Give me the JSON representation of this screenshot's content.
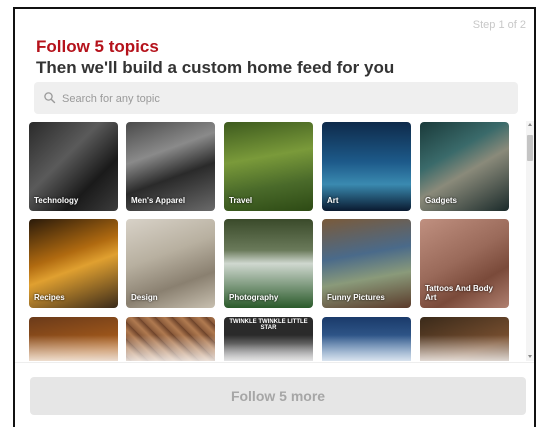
{
  "modal": {
    "step": "Step 1 of 2",
    "title": "Follow 5 topics",
    "subtitle": "Then we'll build a custom home feed for you"
  },
  "search": {
    "placeholder": "Search for any topic",
    "icon": "search-icon"
  },
  "topics": [
    {
      "label": "Technology",
      "background": "linear-gradient(135deg,#2a2a2a 0%,#5a5a5a 40%,#1a1a1a 70%,#3c3c3c 100%)"
    },
    {
      "label": "Men's Apparel",
      "background": "linear-gradient(160deg,#4a4a4a 0%,#8a8a8a 35%,#2a2a2a 60%,#6a6a6a 100%)"
    },
    {
      "label": "Travel",
      "background": "linear-gradient(170deg,#3d5a1e 0%,#7a9a3a 40%,#4a6a2a 70%,#2d4a14 100%)"
    },
    {
      "label": "Art",
      "background": "linear-gradient(180deg,#0e2a4a 0%,#1d5a8a 45%,#3a8ab0 70%,#0a1a30 100%)"
    },
    {
      "label": "Gadgets",
      "background": "linear-gradient(150deg,#1a3a3a 0%,#3a6a6a 35%,#8a8a7a 55%,#1a2a2a 100%)"
    },
    {
      "label": "Recipes",
      "background": "linear-gradient(160deg,#2a1a0a 0%,#b06a10 40%,#e0a030 55%,#3a2a1a 100%)"
    },
    {
      "label": "Design",
      "background": "linear-gradient(160deg,#d8d2c8 0%,#b8b0a0 40%,#8a8070 70%,#c8c0b0 100%)"
    },
    {
      "label": "Photography",
      "background": "linear-gradient(180deg,#3a4a2a 0%,#6a7a5a 35%,#d0d8d0 50%,#2a5a2a 100%)"
    },
    {
      "label": "Funny Pictures",
      "background": "linear-gradient(170deg,#7a5a3a 0%,#4a6a8a 40%,#8a9a7a 65%,#5a3a2a 100%)"
    },
    {
      "label": "Tattoos And Body Art",
      "background": "linear-gradient(150deg,#c09080 0%,#9a6a5a 45%,#7a4a3a 70%,#b08070 100%)"
    },
    {
      "label": "",
      "background": "linear-gradient(170deg,#6a3a1a 0%,#b0601a 45%,#8a4a20 100%)"
    },
    {
      "label": "",
      "background": "repeating-linear-gradient(45deg,#8a5a3a 0px,#b07a50 6px,#6a4028 12px)"
    },
    {
      "label": "",
      "background": "linear-gradient(180deg,#2a2a2a 0%,#2a2a2a 30%,#9a9aa0 55%,#5a5a60 100%)"
    },
    {
      "label": "",
      "background": "linear-gradient(180deg,#1a3a6a 0%,#4a7ab0 50%,#c0d0e0 100%)"
    },
    {
      "label": "",
      "background": "linear-gradient(160deg,#3a2a1a 0%,#7a5030 45%,#2a1a10 100%)"
    }
  ],
  "partial_tile_text": "TWINKLE TWINKLE LITTLE STAR",
  "footer": {
    "button_label": "Follow 5 more"
  },
  "colors": {
    "title_red": "#b5121b",
    "title_dark": "#333333",
    "button_bg": "#e6e6e6",
    "button_text": "#a6a6a6"
  }
}
